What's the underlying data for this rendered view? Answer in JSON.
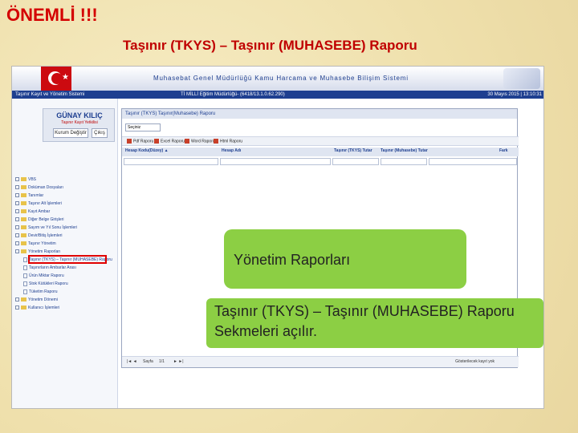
{
  "slide": {
    "warning": "ÖNEMLİ !!!",
    "title": "Taşınır (TKYS) – Taşınır (MUHASEBE) Raporu"
  },
  "app": {
    "banner_title": "Muhasebat Genel Müdürlüğü Kamu Harcama ve Muhasebe Bilişim Sistemi",
    "system_name": "Taşınır Kayıt ve Yönetim Sistemi",
    "unit": "Tİ MİLLİ Eğitim Müdürlüğü- (6418/13.1.0.62.290)",
    "datetime": "30 Mayıs 2015 | 13:10:31"
  },
  "user": {
    "name": "GÜNAY KILIÇ",
    "role": "Taşınır Kayıt Yetkilisi",
    "change_unit_label": "Kurum Değiştir",
    "logout_label": "Çıkış"
  },
  "tree": [
    {
      "label": "VBS",
      "kind": "folder"
    },
    {
      "label": "Doküman Dosyaları",
      "kind": "folder"
    },
    {
      "label": "Tanımlar",
      "kind": "folder"
    },
    {
      "label": "Taşınır Alt İşlemleri",
      "kind": "folder"
    },
    {
      "label": "Kayıt Ambar",
      "kind": "folder"
    },
    {
      "label": "Diğer Belge Girişleri",
      "kind": "folder"
    },
    {
      "label": "Sayım ve Yıl Sonu İşlemleri",
      "kind": "folder"
    },
    {
      "label": "Devir/Bitiş İşlemleri",
      "kind": "folder"
    },
    {
      "label": "Taşınır Yönetim",
      "kind": "folder"
    },
    {
      "label": "Yönetim Raporları",
      "kind": "folder"
    },
    {
      "label": "Taşınır (TKYS) – Taşınır (MUHASEBE) Raporu",
      "kind": "doc"
    },
    {
      "label": "Taşınırların Ambarlar Arası",
      "kind": "doc"
    },
    {
      "label": "Ürün Miktar Raporu",
      "kind": "doc"
    },
    {
      "label": "Stok Kütükleri Raporu",
      "kind": "doc"
    },
    {
      "label": "Tüketim Raporu",
      "kind": "doc"
    },
    {
      "label": "Yönetim Dönemi",
      "kind": "folder"
    },
    {
      "label": "Kullanıcı İşlemleri",
      "kind": "folder"
    }
  ],
  "panel": {
    "header": "Taşınır (TKYS) Taşınır(Muhasebe) Raporu",
    "select_value": "Seçiniz",
    "tools": [
      "Pdf Raporu",
      "Excel Raporu",
      "Word Raporu",
      "Html Raporu"
    ],
    "columns": [
      "Hesap Kodu(Düzey) ▲",
      "Hesap Adı",
      "Taşınır (TKYS) Tutar",
      "Taşınır (Muhasebe) Tutar",
      "Fark"
    ],
    "pager_label": "Sayfa",
    "pager_value": "1/1",
    "pager_status": "Gösterilecek kayıt yok"
  },
  "callouts": {
    "box1": "Yönetim Raporları",
    "box2": "Taşınır (TKYS) – Taşınır (MUHASEBE) Raporu Sekmeleri açılır."
  },
  "colors": {
    "warning": "#d40000",
    "title": "#c00000",
    "callout": "#8ccf44",
    "nav_bar": "#1e3f90"
  }
}
